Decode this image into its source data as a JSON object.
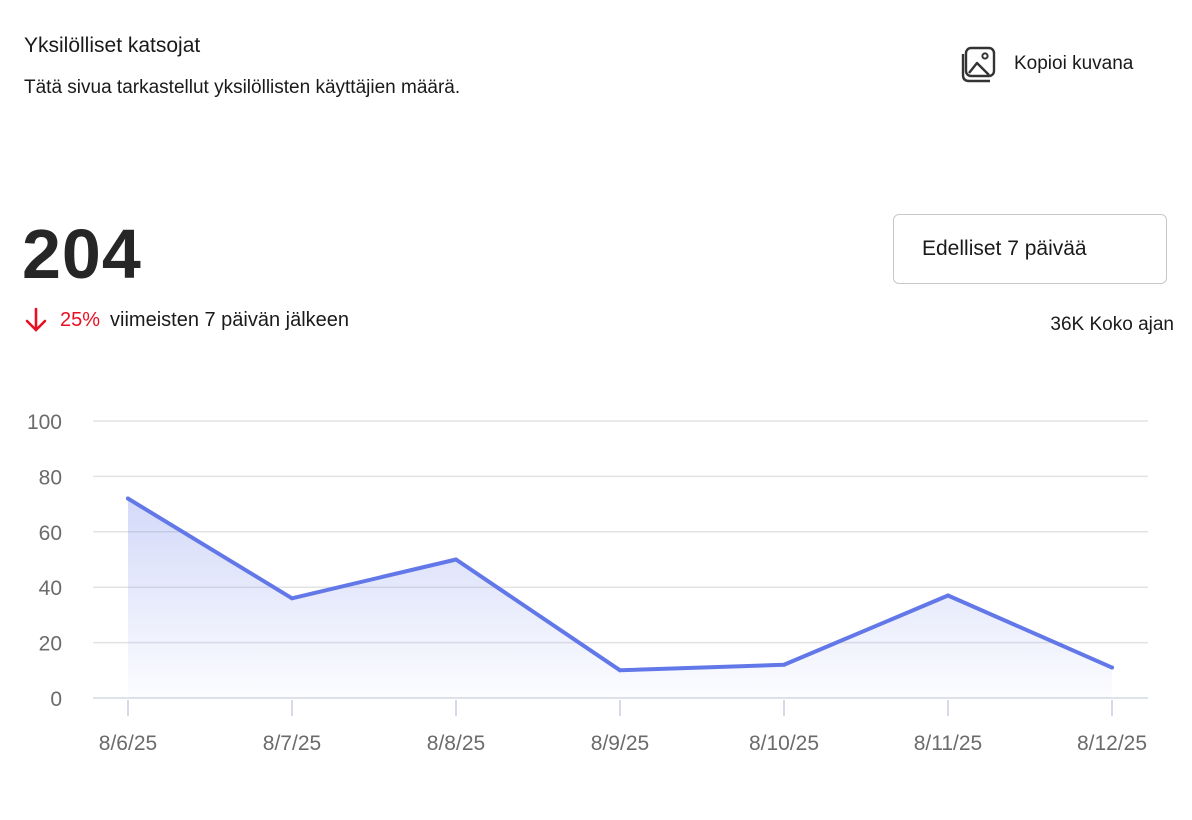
{
  "header": {
    "title": "Yksilölliset katsojat",
    "subtitle": "Tätä sivua tarkastellut yksilöllisten käyttäjien määrä.",
    "copy_label": "Kopioi kuvana",
    "copy_icon": "image-icon"
  },
  "summary": {
    "value": "204",
    "change_percent": "25%",
    "change_direction": "down",
    "change_text": "viimeisten 7 päivän jälkeen",
    "arrow_icon": "arrow-down-icon",
    "range_label": "Edelliset 7 päivää",
    "all_time": "36K Koko ajan"
  },
  "colors": {
    "line": "#6378e8",
    "down": "#e81123",
    "grid": "#e3e3e3",
    "axis_text": "#6b6b6b"
  },
  "chart_data": {
    "type": "area",
    "categories": [
      "8/6/25",
      "8/7/25",
      "8/8/25",
      "8/9/25",
      "8/10/25",
      "8/11/25",
      "8/12/25"
    ],
    "series": [
      {
        "values": [
          72,
          36,
          50,
          10,
          12,
          37,
          11
        ]
      }
    ],
    "yticks": [
      0,
      20,
      40,
      60,
      80,
      100
    ],
    "ylim": [
      0,
      100
    ],
    "grid": true,
    "legend": "none"
  }
}
